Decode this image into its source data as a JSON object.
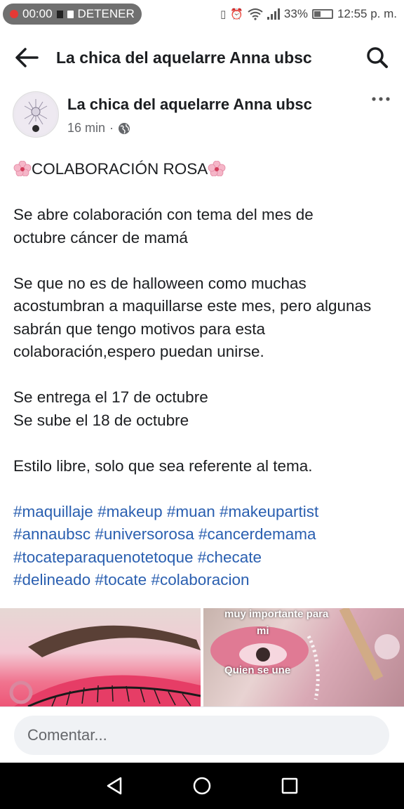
{
  "status_bar": {
    "recording_time": "00:00",
    "stop_label": "DETENER",
    "battery": "33%",
    "time": "12:55 p. m."
  },
  "header": {
    "title": "La chica del aquelarre Anna ubsc"
  },
  "post": {
    "author": "La chica del aquelarre Anna ubsc",
    "time_ago": "16 min",
    "title_line": "COLABORACIÓN ROSA",
    "paragraph_1": "Se abre colaboración con tema del mes de octubre cáncer de mamá",
    "paragraph_2": "Se que no es  de halloween como muchas acostumbran a maquillarse este mes, pero algunas sabrán que tengo motivos para esta colaboración,espero puedan unirse.",
    "line_delivery": "Se entrega el 17 de octubre",
    "line_upload": "Se sube el 18 de octubre",
    "paragraph_style": "Estilo libre, solo que sea referente al tema.",
    "hashtags": [
      "#maquillaje",
      "#makeup",
      "#muan",
      "#makeupartist",
      "#annaubsc",
      "#universorosa",
      "#cancerdemama",
      "#tocateparaquenotetoque",
      "#checate",
      "#delineado",
      "#tocate",
      "#colaboracion"
    ],
    "image2_caption_1": "muy importante para",
    "image2_caption_2": "mi",
    "image2_caption_3": "Quien se une"
  },
  "comment": {
    "placeholder": "Comentar..."
  },
  "colors": {
    "link": "#2a5fb0",
    "text": "#1c1e21",
    "muted": "#65676b"
  }
}
